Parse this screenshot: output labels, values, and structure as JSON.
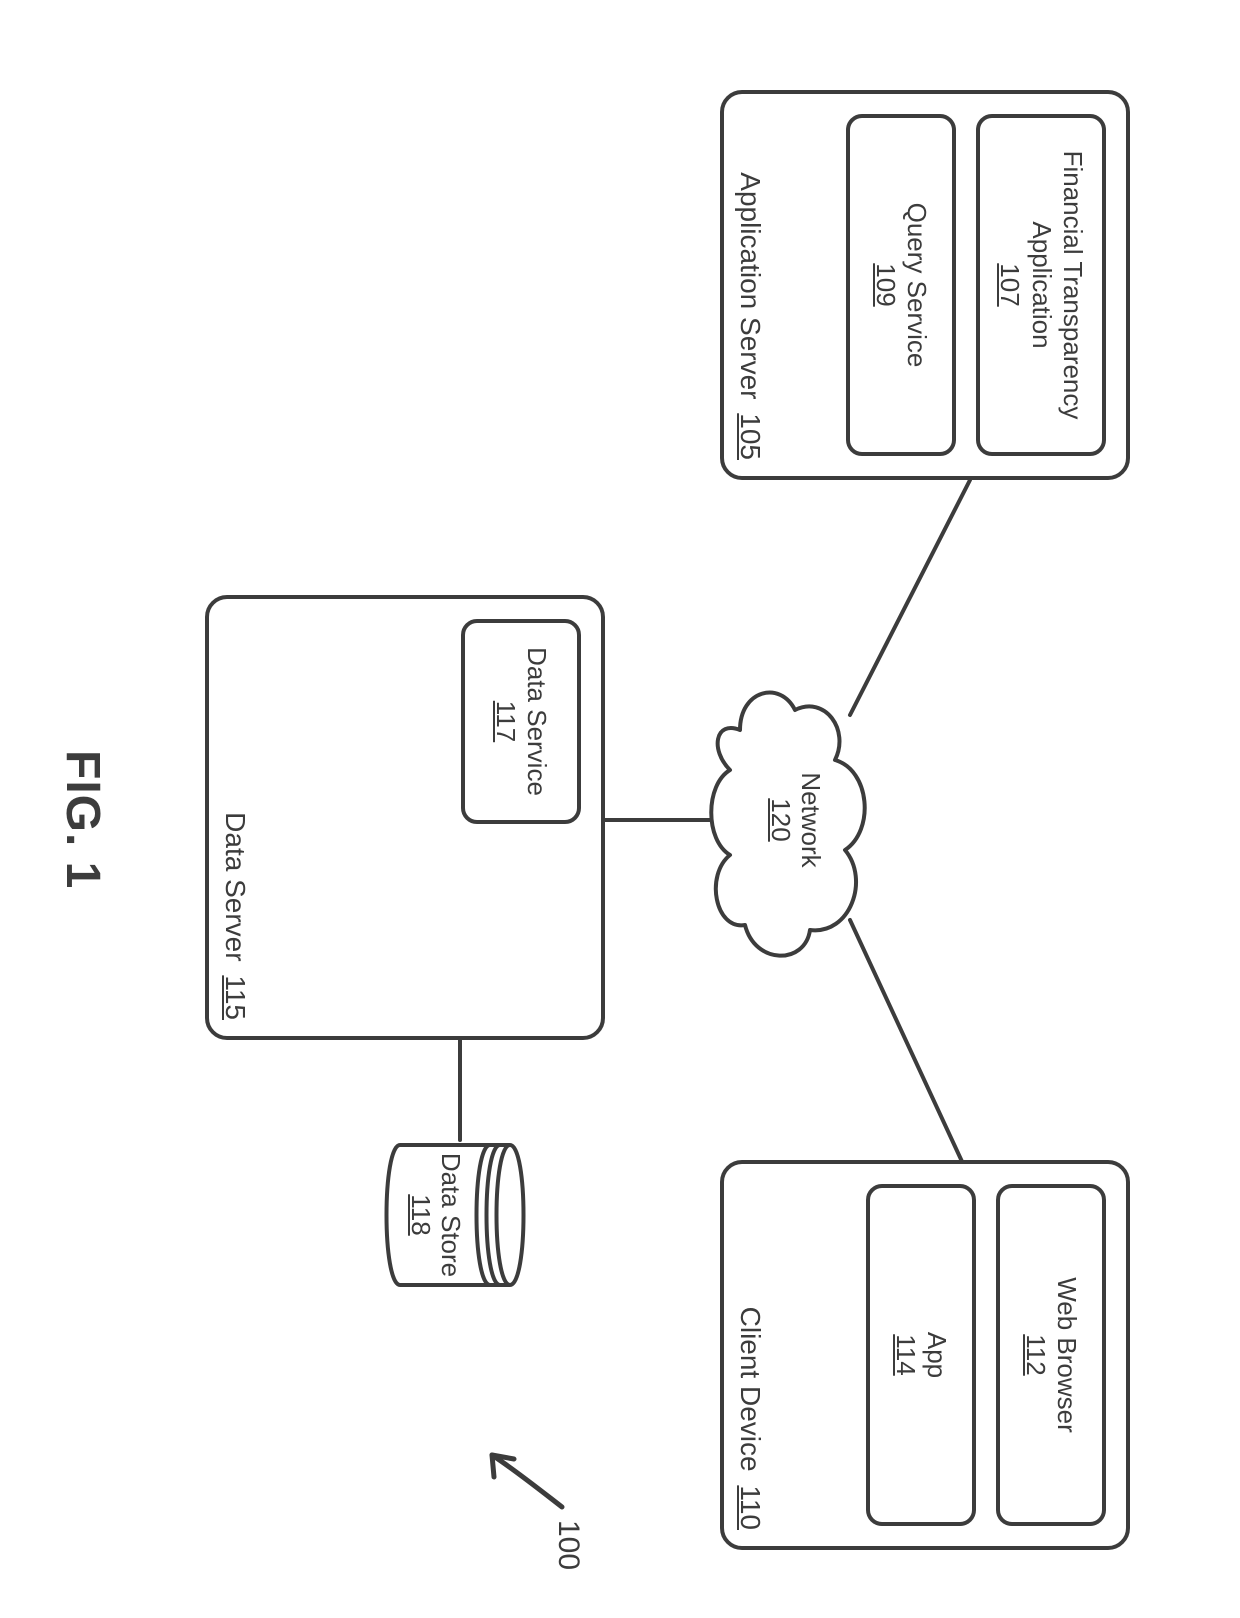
{
  "figure_ref": "100",
  "caption": "FIG. 1",
  "network": {
    "label": "Network",
    "ref": "120"
  },
  "app_server": {
    "label": "Application Server",
    "ref": "105",
    "children": {
      "fta": {
        "label": "Financial Transparency Application",
        "ref": "107"
      },
      "qs": {
        "label": "Query Service",
        "ref": "109"
      }
    }
  },
  "client_device": {
    "label": "Client Device",
    "ref": "110",
    "children": {
      "browser": {
        "label": "Web Browser",
        "ref": "112"
      },
      "app": {
        "label": "App",
        "ref": "114"
      }
    }
  },
  "data_server": {
    "label": "Data Server",
    "ref": "115",
    "children": {
      "svc": {
        "label": "Data Service",
        "ref": "117"
      }
    }
  },
  "data_store": {
    "label": "Data Store",
    "ref": "118"
  }
}
